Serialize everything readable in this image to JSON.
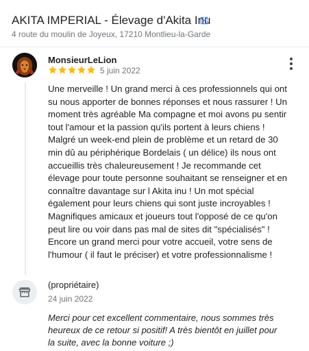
{
  "business": {
    "title": "AKITA IMPERIAL - Élevage d'Akita Inu",
    "address": "4 route du moulin de Joyeux, 17210 Montlieu-la-Garde",
    "open_icon": "external-link-icon"
  },
  "review": {
    "author": "MonsieurLeLion",
    "rating": 5,
    "date": "5 juin 2022",
    "text": "Une merveille ! Un grand merci à ces professionnels qui ont su nous apporter de bonnes réponses et nous rassurer ! Un moment très agréable Ma compagne et moi avons pu sentir tout l'amour et la passion qu'ils portent à leurs chiens ! Malgré un week-end plein de problème et un retard de 30 min dû au périphérique Bordelais ( un délice) ils nous ont accueillis très chaleureusement ! Je recommande cet élevage pour toute personne souhaitant se renseigner et en connaître davantage sur l Akita inu ! Un mot spécial également pour leurs chiens qui sont juste incroyables ! Magnifiques amicaux et joueurs tout l'opposé de ce qu'on peut lire ou voir dans pas mal de sites dit \"spécialisés\" ! Encore un grand merci pour votre accueil, votre sens de l'humour ( il faut le préciser) et votre professionnalisme !",
    "star_color": "#fbbc04",
    "avatar_icon": "lion-avatar"
  },
  "owner_reply": {
    "label": "(propriétaire)",
    "date": "24 juin 2022",
    "text": "Merci pour cet excellent commentaire, nous sommes très heureux de ce retour si positif! A très bientôt en juillet pour la suite, avec la bonne voiture ;)",
    "avatar_icon": "storefront-icon"
  }
}
